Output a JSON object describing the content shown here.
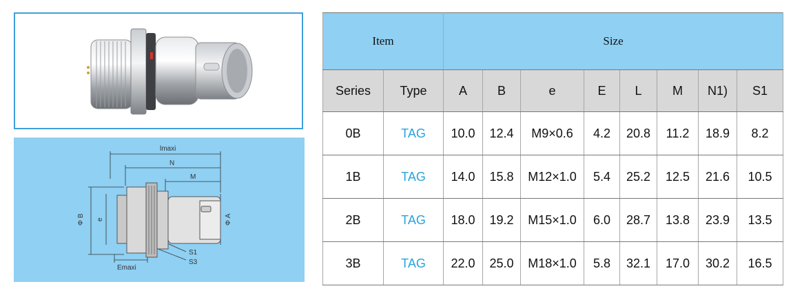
{
  "table": {
    "group_headers": {
      "item": "Item",
      "size": "Size"
    },
    "columns": [
      "Series",
      "Type",
      "A",
      "B",
      "e",
      "E",
      "L",
      "M",
      "N1)",
      "S1"
    ],
    "rows": [
      {
        "series": "0B",
        "type": "TAG",
        "A": "10.0",
        "B": "12.4",
        "e": "M9×0.6",
        "E": "4.2",
        "L": "20.8",
        "M": "11.2",
        "N1": "18.9",
        "S1": "8.2"
      },
      {
        "series": "1B",
        "type": "TAG",
        "A": "14.0",
        "B": "15.8",
        "e": "M12×1.0",
        "E": "5.4",
        "L": "25.2",
        "M": "12.5",
        "N1": "21.6",
        "S1": "10.5"
      },
      {
        "series": "2B",
        "type": "TAG",
        "A": "18.0",
        "B": "19.2",
        "e": "M15×1.0",
        "E": "6.0",
        "L": "28.7",
        "M": "13.8",
        "N1": "23.9",
        "S1": "13.5"
      },
      {
        "series": "3B",
        "type": "TAG",
        "A": "22.0",
        "B": "25.0",
        "e": "M18×1.0",
        "E": "5.8",
        "L": "32.1",
        "M": "17.0",
        "N1": "30.2",
        "S1": "16.5"
      }
    ]
  },
  "drawing": {
    "labels": {
      "lmaxi": "lmaxi",
      "n": "N",
      "m": "M",
      "phi_b": "Φ B",
      "phi_a": "Φ A",
      "phi_e": "e",
      "s1": "S1",
      "s3": "S3",
      "emaxi": "Emaxi"
    }
  },
  "colors": {
    "header_bg": "#8fd0f3",
    "label_bg": "#d8d8d8",
    "type_text": "#27a3dc",
    "photo_border": "#3f9fdc"
  }
}
